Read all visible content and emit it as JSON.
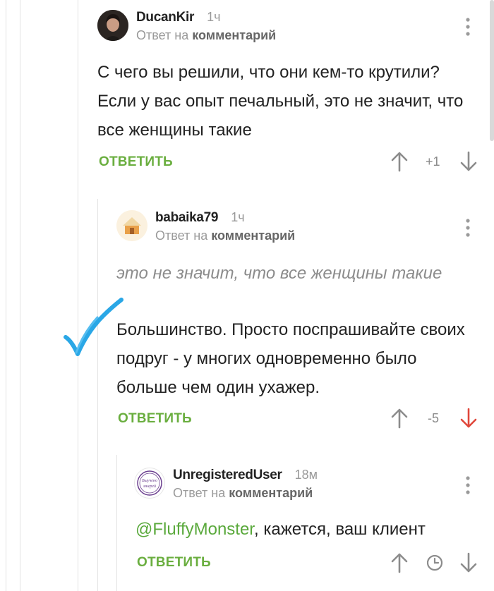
{
  "comments": [
    {
      "username": "DucanKir",
      "time": "1ч",
      "reply_prefix": "Ответ на",
      "reply_target": "комментарий",
      "text": "С чего вы решили, что они кем-то крутили? Если у вас опыт печальный, это не значит, что все женщины такие",
      "reply_label": "ОТВЕТИТЬ",
      "score": "+1"
    },
    {
      "username": "babaika79",
      "time": "1ч",
      "reply_prefix": "Ответ на",
      "reply_target": "комментарий",
      "quote": "это не значит, что все женщины такие",
      "text": "Большинство. Просто поспрашивайте своих подруг - у многих одновременно было больше чем один ухажер.",
      "reply_label": "ОТВЕТИТЬ",
      "score": "-5"
    },
    {
      "username": "UnregisteredUser",
      "time": "18м",
      "reply_prefix": "Ответ на",
      "reply_target": "комментарий",
      "mention": "@FluffyMonster",
      "text": ", кажется, ваш клиент",
      "reply_label": "ОТВЕТИТЬ",
      "stamp_text": "Выучено\nмнерей"
    }
  ],
  "colors": {
    "reply_green": "#6aae3f",
    "mention_green": "#5aa93c",
    "downvote_active": "#e0463a",
    "checkmark_blue": "#2aa7e6"
  },
  "icons": [
    "kebab-menu-icon",
    "upvote-arrow-icon",
    "downvote-arrow-icon",
    "clock-icon",
    "checkmark-annotation-icon"
  ]
}
